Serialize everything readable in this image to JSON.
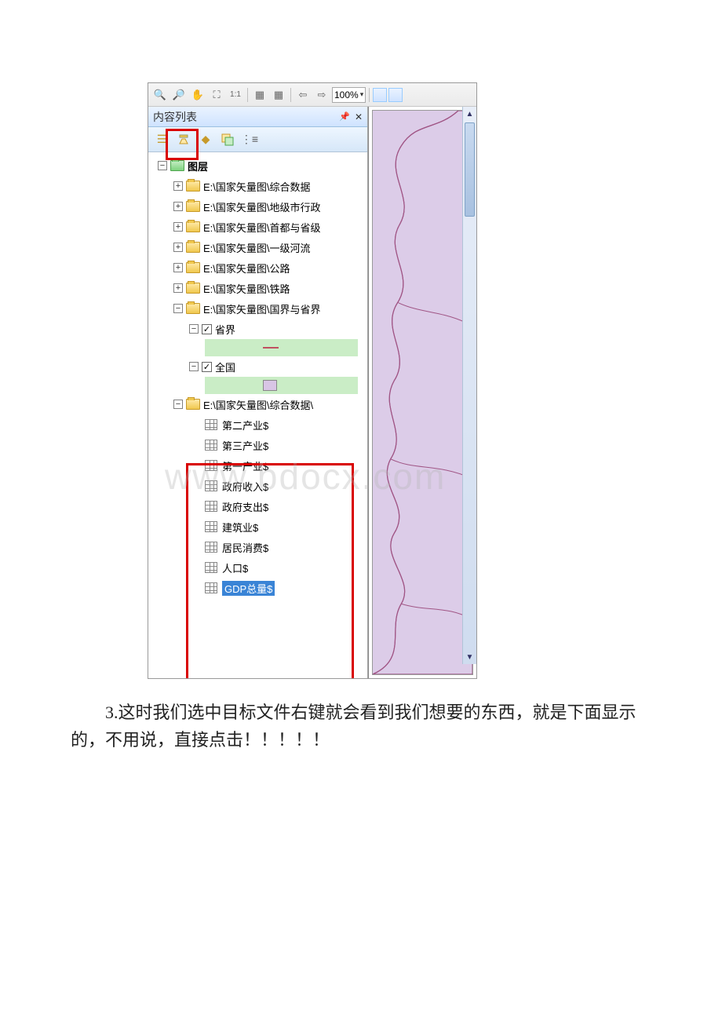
{
  "watermark": "www.bdocx.com",
  "caption": "3.这时我们选中目标文件右键就会看到我们想要的东西，就是下面显示的，不用说，直接点击！！！！！",
  "toolbar": {
    "zoom_value": "100%"
  },
  "panel": {
    "title": "内容列表",
    "pin_icon": "📌",
    "close_icon": "✕"
  },
  "tree": {
    "root": "图层",
    "folders": [
      "E:\\国家矢量图\\综合数据",
      "E:\\国家矢量图\\地级市行政",
      "E:\\国家矢量图\\首都与省级",
      "E:\\国家矢量图\\一级河流",
      "E:\\国家矢量图\\公路",
      "E:\\国家矢量图\\铁路"
    ],
    "open_folder": "E:\\国家矢量图\\国界与省界",
    "layers": [
      {
        "name": "省界",
        "checked": true
      },
      {
        "name": "全国",
        "checked": true
      }
    ],
    "data_folder": "E:\\国家矢量图\\综合数据\\",
    "tables": [
      "第二产业$",
      "第三产业$",
      "第一产业$",
      "政府收入$",
      "政府支出$",
      "建筑业$",
      "居民消费$",
      "人口$",
      "GDP总量$"
    ],
    "selected_table_index": 8
  }
}
